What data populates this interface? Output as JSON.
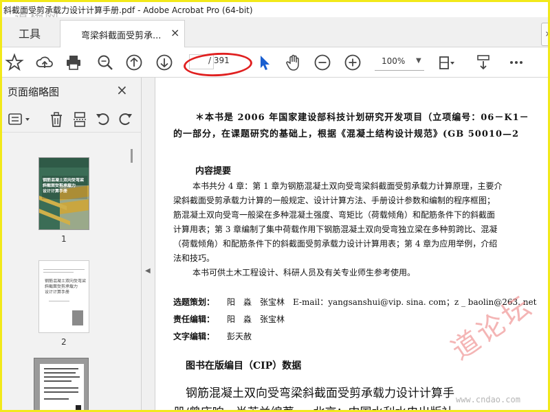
{
  "window": {
    "title": "斜截面受剪承载力设计计算手册.pdf - Adobe Acrobat Pro (64-bit)"
  },
  "watermark": {
    "top": "道杨网",
    "diagonal": "道论坛",
    "url": "www.cndao.com"
  },
  "tabs": {
    "tools": "工具",
    "doc": "弯梁斜截面受剪承...",
    "close": "×",
    "next": "›"
  },
  "toolbar": {
    "page_current": "",
    "page_total": "/ 391",
    "zoom": "100%",
    "icons": [
      "star-icon",
      "cloud-upload-icon",
      "print-icon",
      "zoom-search-icon",
      "page-up-icon",
      "page-down-icon",
      "select-cursor-icon",
      "hand-icon",
      "zoom-out-icon",
      "zoom-in-icon",
      "page-display-icon",
      "scroll-mode-icon",
      "more-icon"
    ]
  },
  "thumbnails": {
    "title": "页面缩略图",
    "close": "×",
    "pages": [
      {
        "number": "1",
        "cover": [
          "钢筋混凝土双向受弯梁",
          "斜截面受剪承载力",
          "设计计算手册"
        ]
      },
      {
        "number": "2",
        "cover": [
          "钢筋混凝土双向受弯梁",
          "斜截面受剪承载力",
          "设计计算手册"
        ]
      }
    ]
  },
  "document": {
    "note1": "＊本书是 2006 年国家建设部科技计划研究开发项目（立项编号：06－K1－",
    "note2": "的一部分，在课题研究的基础上，根据《混凝土结构设计规范》(GB 50010—2",
    "summary_title": "内容提要",
    "summary_lines": [
      "本书共分 4 章：第 1 章为钢筋混凝土双向受弯梁斜截面受剪承载力计算原理，主要介",
      "梁斜截面受剪承载力计算的一般规定、设计计算方法、手册设计参数和编制的程序框图；",
      "筋混凝土双向受弯一般梁在多种混凝土强度、弯矩比（荷载倾角）和配筋条件下的斜截面",
      "计算用表；第 3 章编制了集中荷载作用下钢筋混凝土双向受弯独立梁在多种剪跨比、混凝",
      "（荷载倾角）和配筋条件下的斜截面受剪承载力设计计算用表；第 4 章为应用举例，介绍",
      "法和技巧。",
      "本书可供土木工程设计、科研人员及有关专业师生参考使用。"
    ],
    "planner_label": "选题策划：",
    "planner_value": "阳　淼　张宝林　E-mail：yangsanshui@vip. sina. com；z _ baolin@263. net",
    "editor_label": "责任编辑：",
    "editor_value": "阳　淼　张宝林",
    "text_editor_label": "文字编辑：",
    "text_editor_value": "彭天赦",
    "cip_title": "图书在版编目（CIP）数据",
    "cip_line1": "钢筋混凝土双向受弯梁斜截面受剪承载力设计计算手",
    "cip_line2": "册/曾庆响，肖芝兰编著. —北京：中国水利水电出版社，"
  },
  "colors": {
    "highlight_ring": "#e02020",
    "frame": "#f2e91a",
    "accent_blue": "#1a5fd0"
  }
}
